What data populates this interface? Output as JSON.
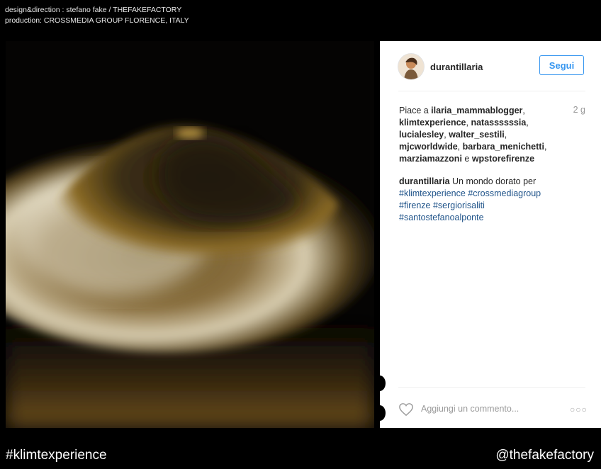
{
  "credits": {
    "line1": "design&direction : stefano fake / THEFAKEFACTORY",
    "line2": "production: CROSSMEDIA GROUP FLORENCE, ITALY"
  },
  "post": {
    "username": "durantillaria",
    "follow_label": "Segui",
    "time": "2 g",
    "likes": {
      "prefix": "Piace a ",
      "users": [
        "ilaria_mammablogger",
        "klimtexperience",
        "natassssssia",
        "lucialesley",
        "walter_sestili",
        "mjcworldwide",
        "barbara_menichetti",
        "marziamazzoni"
      ],
      "conjunction": " e ",
      "last_user": "wpstorefirenze"
    },
    "caption": {
      "author": "durantillaria",
      "text": " Un mondo dorato per ",
      "hashtags": [
        "#klimtexperience",
        "#crossmediagroup",
        "#firenze",
        "#sergiorisaliti",
        "#santostefanoalponte"
      ]
    },
    "comment_placeholder": "Aggiungi un commento...",
    "more_glyph": "○○○"
  },
  "footer": {
    "left": "#klimtexperience",
    "right": "@thefakefactory"
  },
  "colors": {
    "accent": "#3897f0",
    "hashtag": "#20548a",
    "gold": "#c9a24a"
  }
}
